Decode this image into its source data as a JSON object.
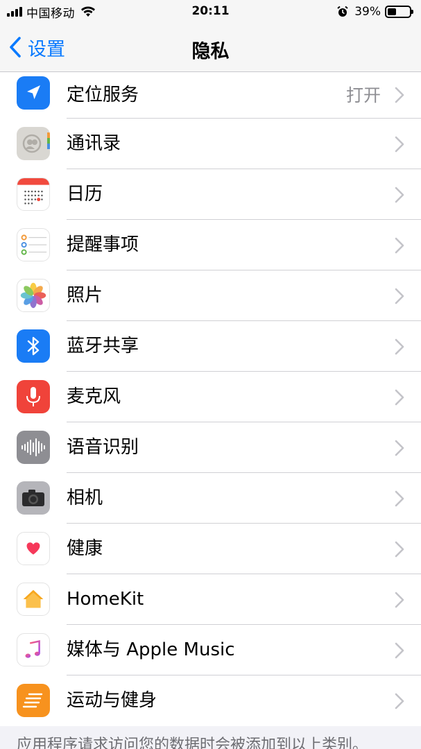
{
  "status_bar": {
    "carrier": "中国移动",
    "time": "20:11",
    "battery_percent": "39%",
    "battery_level": 0.39,
    "icons": [
      "signal-icon",
      "wifi-icon",
      "alarm-icon",
      "battery-icon"
    ]
  },
  "nav": {
    "back_label": "设置",
    "title": "隐私"
  },
  "items": [
    {
      "label": "定位服务",
      "value": "打开",
      "icon": "location-icon"
    },
    {
      "label": "通讯录",
      "value": "",
      "icon": "contacts-icon"
    },
    {
      "label": "日历",
      "value": "",
      "icon": "calendar-icon"
    },
    {
      "label": "提醒事项",
      "value": "",
      "icon": "reminders-icon"
    },
    {
      "label": "照片",
      "value": "",
      "icon": "photos-icon"
    },
    {
      "label": "蓝牙共享",
      "value": "",
      "icon": "bluetooth-icon"
    },
    {
      "label": "麦克风",
      "value": "",
      "icon": "microphone-icon"
    },
    {
      "label": "语音识别",
      "value": "",
      "icon": "speech-recognition-icon"
    },
    {
      "label": "相机",
      "value": "",
      "icon": "camera-icon"
    },
    {
      "label": "健康",
      "value": "",
      "icon": "health-icon"
    },
    {
      "label": "HomeKit",
      "value": "",
      "icon": "homekit-icon"
    },
    {
      "label": "媒体与 Apple Music",
      "value": "",
      "icon": "music-icon"
    },
    {
      "label": "运动与健身",
      "value": "",
      "icon": "motion-fitness-icon"
    }
  ],
  "footer": "应用程序请求访问您的数据时会被添加到以上类别。",
  "colors": {
    "accent": "#0a7aff",
    "background": "#f2f2f7",
    "secondary_text": "#8e8e93"
  }
}
